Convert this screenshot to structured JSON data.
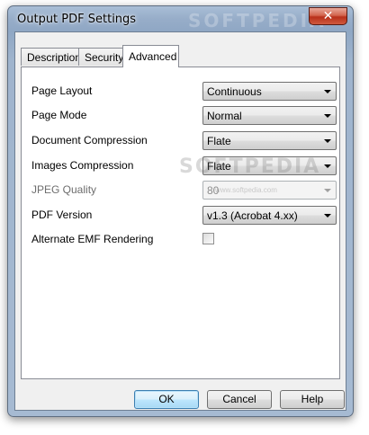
{
  "window": {
    "title": "Output PDF Settings",
    "close_glyph": "✕",
    "watermark": "SOFTPEDIA",
    "watermark_small": "www.softpedia.com"
  },
  "tabs": [
    {
      "label": "Description",
      "active": false
    },
    {
      "label": "Security",
      "active": false
    },
    {
      "label": "Advanced",
      "active": true
    }
  ],
  "settings": {
    "page_layout": {
      "label": "Page Layout",
      "value": "Continuous"
    },
    "page_mode": {
      "label": "Page Mode",
      "value": "Normal"
    },
    "document_compression": {
      "label": "Document Compression",
      "value": "Flate"
    },
    "images_compression": {
      "label": "Images Compression",
      "value": "Flate"
    },
    "jpeg_quality": {
      "label": "JPEG Quality",
      "value": "80",
      "disabled": true
    },
    "pdf_version": {
      "label": "PDF Version",
      "value": "v1.3 (Acrobat 4.xx)"
    },
    "alternate_emf": {
      "label": "Alternate EMF Rendering",
      "checked": false
    }
  },
  "buttons": {
    "ok": "OK",
    "cancel": "Cancel",
    "help": "Help"
  }
}
